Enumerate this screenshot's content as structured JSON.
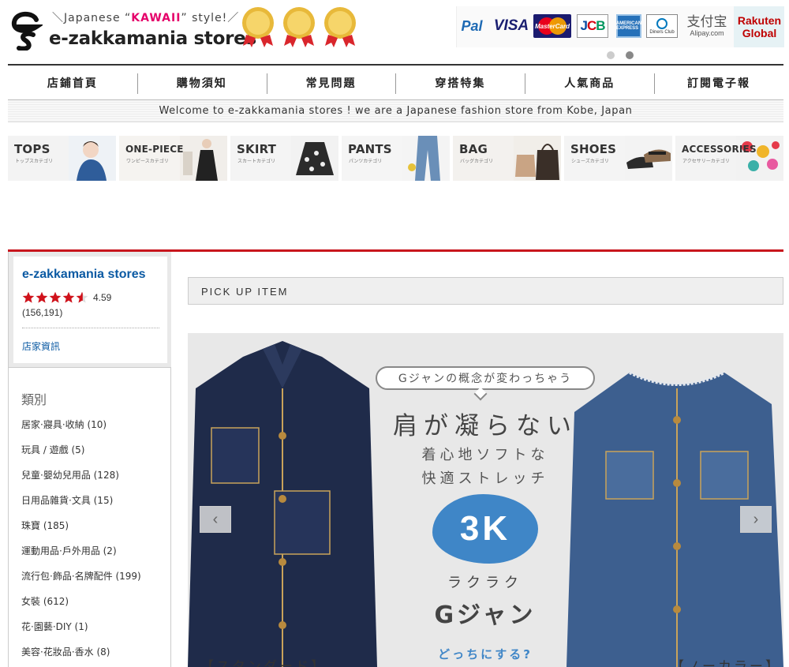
{
  "header": {
    "tagline_prefix": "＼Japanese “",
    "tagline_kawaii": "KAWAII",
    "tagline_suffix": "” style!／",
    "brand": "e-zakkamania stores",
    "payments": {
      "paypal": "Pal",
      "visa": "VISA",
      "mastercard": "MasterCard",
      "jcb_j": "J",
      "jcb_c": "C",
      "jcb_b": "B",
      "amex": "AMERICAN EXPRESS",
      "diners": "Diners Club",
      "alipay_zh": "支付宝",
      "alipay_en": "Alipay.com",
      "rakuten_1": "Rakuten",
      "rakuten_2": "Global"
    }
  },
  "nav": {
    "items": [
      "店鋪首頁",
      "購物須知",
      "常見問題",
      "穿搭特集",
      "人氣商品",
      "訂閱電子報"
    ]
  },
  "welcome": "Welcome to e-zakkamania stores ! we are a Japanese fashion store from Kobe, Japan",
  "categories": [
    {
      "title": "TOPS",
      "sub": "トップスカテゴリ"
    },
    {
      "title": "ONE-PIECE",
      "sub": "ワンピースカテゴリ"
    },
    {
      "title": "SKIRT",
      "sub": "スカートカテゴリ"
    },
    {
      "title": "PANTS",
      "sub": "パンツカテゴリ"
    },
    {
      "title": "BAG",
      "sub": "バッグカテゴリ"
    },
    {
      "title": "SHOES",
      "sub": "シューズカテゴリ"
    },
    {
      "title": "ACCESSORIES",
      "sub": "アクセサリーカテゴリ"
    }
  ],
  "shop": {
    "name": "e-zakkamania stores",
    "rating": "4.59",
    "reviews": "(156,191)",
    "rating_value": 4.59,
    "info_link": "店家資訊"
  },
  "sidebar": {
    "heading": "類別",
    "items": [
      "居家·寢具·收納 (10)",
      "玩具 / 遊戲 (5)",
      "兒童·嬰幼兒用品 (128)",
      "日用品雜貨·文具 (15)",
      "珠寶 (185)",
      "運動用品·戶外用品 (2)",
      "流行包·飾品·名牌配件 (199)",
      "女裝 (612)",
      "花·園藝·DIY (1)",
      "美容·花妝品·香水 (8)"
    ]
  },
  "pickup": {
    "label": "PICK UP ITEM"
  },
  "banner": {
    "bubble": "Gジャンの概念が変わっちゃう",
    "head1": "肩が凝らない",
    "head2": "着心地ソフトな",
    "head3": "快適ストレッチ",
    "badge": "3K",
    "rakuraku": "ラクラク",
    "gjan": "Gジャン",
    "which": "どっちにする?",
    "label_left": "【スタンダード】",
    "label_right": "【ノーカラー】",
    "prev": "‹",
    "next": "›"
  },
  "colors": {
    "accent_red": "#c8161d",
    "link_blue": "#0b5aa3",
    "badge_blue": "#3f86c7",
    "star_red": "#d0121b"
  },
  "icons": {
    "logo": "es-logo-icon",
    "award": "gold-award-badge-icon",
    "star": "star-icon"
  }
}
